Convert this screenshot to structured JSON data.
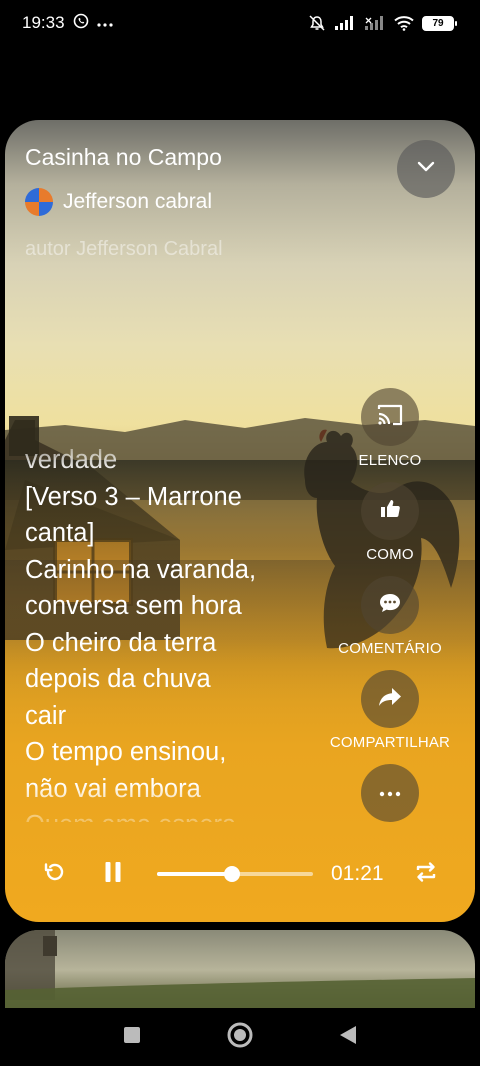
{
  "status_bar": {
    "time": "19:33",
    "battery": "79"
  },
  "song": {
    "title": "Casinha no Campo",
    "artist": "Jefferson cabral",
    "author_line": "autor Jefferson Cabral"
  },
  "lyrics": [
    "verdade",
    "[Verso 3 – Marrone",
    "canta]",
    "Carinho na varanda,",
    "conversa sem hora",
    "O cheiro da terra",
    "depois da chuva",
    "cair",
    "O tempo ensinou,",
    "não vai embora",
    "Quem ama espera"
  ],
  "actions": {
    "cast_label": "ELENCO",
    "like_label": "COMO",
    "comment_label": "COMENTÁRIO",
    "share_label": "COMPARTILHAR"
  },
  "player": {
    "elapsed": "01:21",
    "progress_fraction": 0.48
  },
  "colors": {
    "accent_orange": "#f0a91f",
    "action_bg": "#50463280"
  },
  "icons": [
    "whatsapp-icon",
    "more-icon",
    "mute-icon",
    "signal-icon",
    "wifi-icon",
    "battery-icon",
    "chevron-down-icon",
    "cast-icon",
    "thumbs-up-icon",
    "comment-icon",
    "share-icon",
    "more-horizontal-icon",
    "replay-icon",
    "pause-icon",
    "repeat-icon"
  ]
}
